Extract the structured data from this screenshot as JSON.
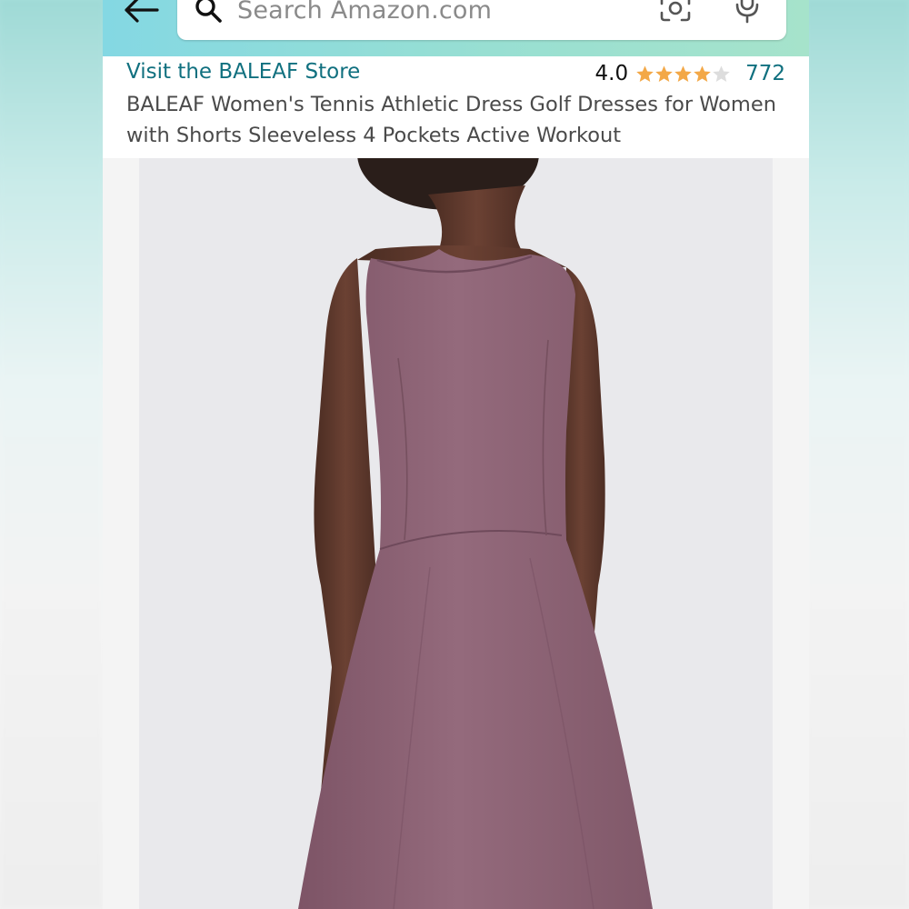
{
  "header": {
    "search_placeholder": "Search Amazon.com",
    "icons": [
      "back-arrow-icon",
      "search-icon",
      "camera-scan-icon",
      "microphone-icon"
    ]
  },
  "product": {
    "store_link": "Visit the BALEAF Store",
    "rating_value": "4.0",
    "stars": {
      "filled": 4,
      "total": 5
    },
    "rating_count": "772",
    "title": "BALEAF Women's Tennis Athletic Dress Golf Dresses for Women with Shorts Sleeveless 4 Pockets Active Workout"
  },
  "colors": {
    "header_gradient_start": "#84d8e3",
    "header_gradient_end": "#a6e3cb",
    "link": "#10707f",
    "star": "#f3a847",
    "star_empty": "#dddddd",
    "dress": "#8e6577",
    "photo_background": "#e9e9ec"
  }
}
